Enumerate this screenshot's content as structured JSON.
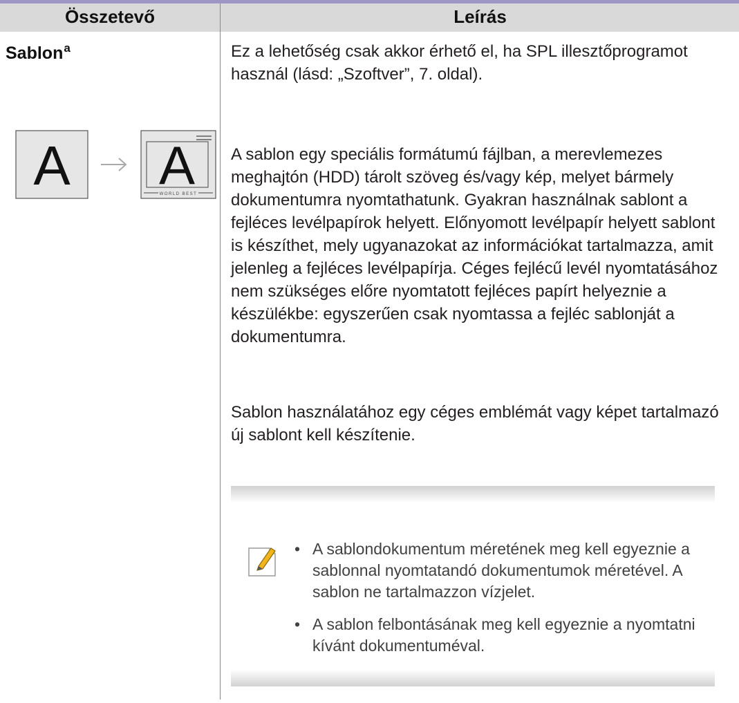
{
  "table": {
    "headers": {
      "component": "Összetevő",
      "description": "Leírás"
    },
    "row": {
      "name": "Sablon",
      "name_superscript": "a",
      "illustration": {
        "letter": "A",
        "footer_text": "WORLD BEST",
        "arrow_icon": "right-arrow"
      },
      "paragraphs": [
        "Ez a lehetőség csak akkor érhető el, ha SPL illesztőprogramot használ (lásd: „Szoftver”, 7. oldal).",
        "A sablon egy speciális formátumú fájlban, a merevlemezes meghajtón (HDD) tárolt szöveg és/vagy kép, melyet bármely dokumentumra nyomtathatunk. Gyakran használnak sablont a fejléces levélpapírok helyett. Előnyomott levélpapír helyett sablont is készíthet, mely ugyanazokat az információkat tartalmazza, amit jelenleg a fejléces levélpapírja. Céges fejlécű levél nyomtatásához nem szükséges előre nyomtatott fejléces papírt helyeznie a készülékbe: egyszerűen csak nyomtassa a fejléc sablonját a dokumentumra.",
        "Sablon használatához egy céges emblémát vagy képet tartalmazó új sablont kell készítenie."
      ],
      "note": {
        "icon": "note-pencil-icon",
        "bullet": "•",
        "items": [
          "A sablondokumentum méretének meg kell egyeznie a sablonnal nyomtatandó dokumentumok méretével. A sablon ne tartalmazzon vízjelet.",
          "A sablon felbontásának meg kell egyeznie a nyomtatni kívánt dokumentuméval."
        ]
      }
    }
  },
  "colors": {
    "header_background": "#d9d9d9",
    "header_top_rule": "#9e96c5",
    "body_text": "#231f20",
    "note_text": "#414042",
    "pencil_accent": "#f2b41b"
  }
}
